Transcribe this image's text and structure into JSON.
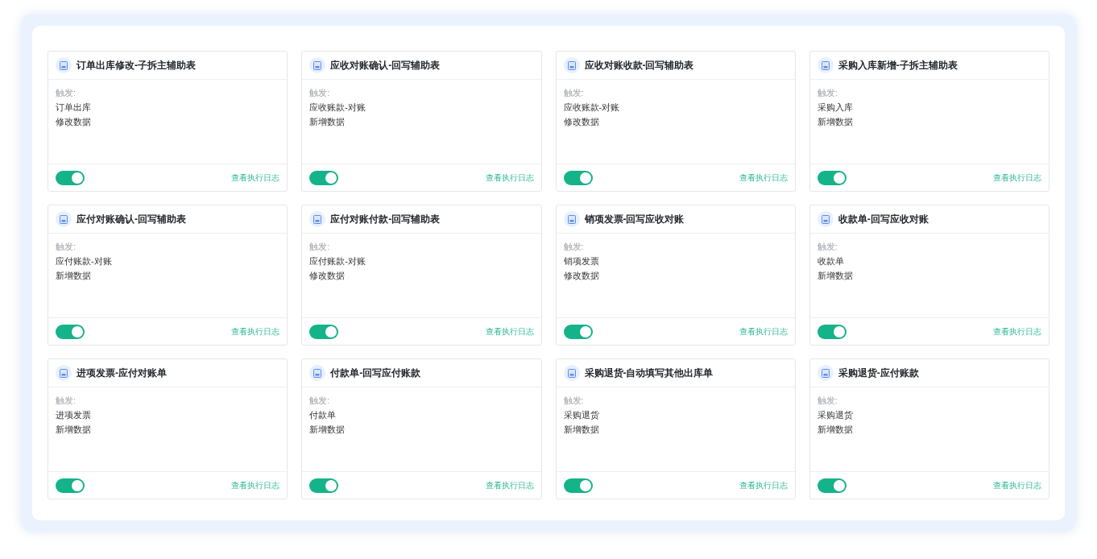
{
  "cards": [
    {
      "title": "订单出库修改-子拆主辅助表",
      "trigger_label": "触发:",
      "source": "订单出库",
      "event": "修改数据",
      "enabled": true,
      "log_link": "查看执行日志"
    },
    {
      "title": "应收对账确认-回写辅助表",
      "trigger_label": "触发:",
      "source": "应收账款-对账",
      "event": "新增数据",
      "enabled": true,
      "log_link": "查看执行日志"
    },
    {
      "title": "应收对账收款-回写辅助表",
      "trigger_label": "触发:",
      "source": "应收账款-对账",
      "event": "修改数据",
      "enabled": true,
      "log_link": "查看执行日志"
    },
    {
      "title": "采购入库新增-子拆主辅助表",
      "trigger_label": "触发:",
      "source": "采购入库",
      "event": "新增数据",
      "enabled": true,
      "log_link": "查看执行日志"
    },
    {
      "title": "应付对账确认-回写辅助表",
      "trigger_label": "触发:",
      "source": "应付账款-对账",
      "event": "新增数据",
      "enabled": true,
      "log_link": "查看执行日志"
    },
    {
      "title": "应付对账付款-回写辅助表",
      "trigger_label": "触发:",
      "source": "应付账款-对账",
      "event": "修改数据",
      "enabled": true,
      "log_link": "查看执行日志"
    },
    {
      "title": "销项发票-回写应收对账",
      "trigger_label": "触发:",
      "source": "销项发票",
      "event": "修改数据",
      "enabled": true,
      "log_link": "查看执行日志"
    },
    {
      "title": "收款单-回写应收对账",
      "trigger_label": "触发:",
      "source": "收款单",
      "event": "新增数据",
      "enabled": true,
      "log_link": "查看执行日志"
    },
    {
      "title": "进项发票-应付对账单",
      "trigger_label": "触发:",
      "source": "进项发票",
      "event": "新增数据",
      "enabled": true,
      "log_link": "查看执行日志"
    },
    {
      "title": "付款单-回写应付账款",
      "trigger_label": "触发:",
      "source": "付款单",
      "event": "新增数据",
      "enabled": true,
      "log_link": "查看执行日志"
    },
    {
      "title": "采购退货-自动填写其他出库单",
      "trigger_label": "触发:",
      "source": "采购退货",
      "event": "新增数据",
      "enabled": true,
      "log_link": "查看执行日志"
    },
    {
      "title": "采购退货-应付账款",
      "trigger_label": "触发:",
      "source": "采购退货",
      "event": "新增数据",
      "enabled": true,
      "log_link": "查看执行日志"
    }
  ]
}
